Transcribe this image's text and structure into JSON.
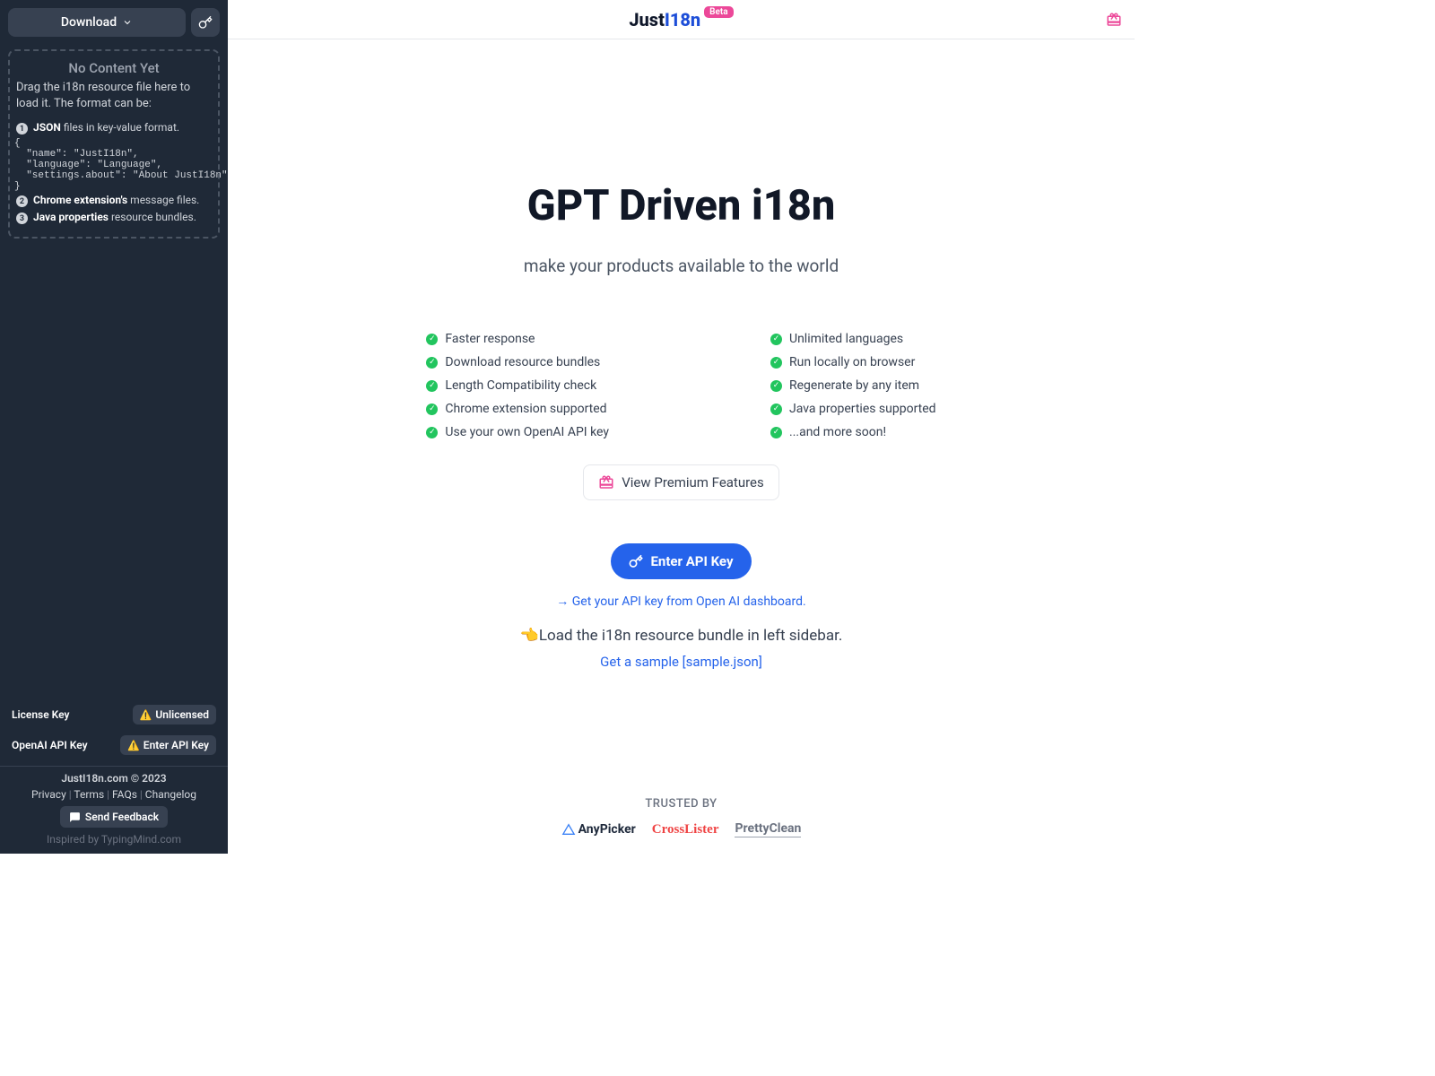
{
  "sidebar": {
    "download_label": "Download",
    "dropzone": {
      "title": "No Content Yet",
      "desc": "Drag the i18n resource file here to load it. The format can be:",
      "format1_strong": "JSON",
      "format1_rest": "files in key-value format.",
      "code": "{\n  \"name\": \"JustI18n\",\n  \"language\": \"Language\",\n  \"settings.about\": \"About JustI18n\"\n}",
      "format2_strong": "Chrome extension's",
      "format2_rest": "message files.",
      "format3_strong": "Java properties",
      "format3_rest": "resource bundles."
    },
    "license": {
      "label": "License Key",
      "status": "Unlicensed"
    },
    "openai": {
      "label": "OpenAI API Key",
      "status": "Enter API Key"
    },
    "copyright": "JustI18n.com © 2023",
    "links": {
      "privacy": "Privacy",
      "terms": "Terms",
      "faqs": "FAQs",
      "changelog": "Changelog"
    },
    "feedback_label": "Send Feedback",
    "inspired_prefix": "Inspired by ",
    "inspired_link": "TypingMind.com"
  },
  "header": {
    "logo_part1": "Just",
    "logo_part2": "I18n",
    "badge": "Beta"
  },
  "main": {
    "title": "GPT Driven i18n",
    "subtitle": "make your products available to the world",
    "features_left": [
      "Faster response",
      "Download resource bundles",
      "Length Compatibility check",
      "Chrome extension supported",
      "Use your own OpenAI API key"
    ],
    "features_right": [
      "Unlimited languages",
      "Run locally on browser",
      "Regenerate by any item",
      "Java properties supported",
      "...and more soon!"
    ],
    "premium_label": "View Premium Features",
    "api_label": "Enter API Key",
    "get_key_link": "→ Get your API key from Open AI dashboard.",
    "load_hint": "Load the i18n resource bundle in left sidebar.",
    "sample_link": "Get a sample [sample.json]",
    "trusted_label": "TRUSTED BY",
    "brands": {
      "anypicker": "AnyPicker",
      "crosslister": "CrossLister",
      "prettyclean": "PrettyClean"
    }
  }
}
